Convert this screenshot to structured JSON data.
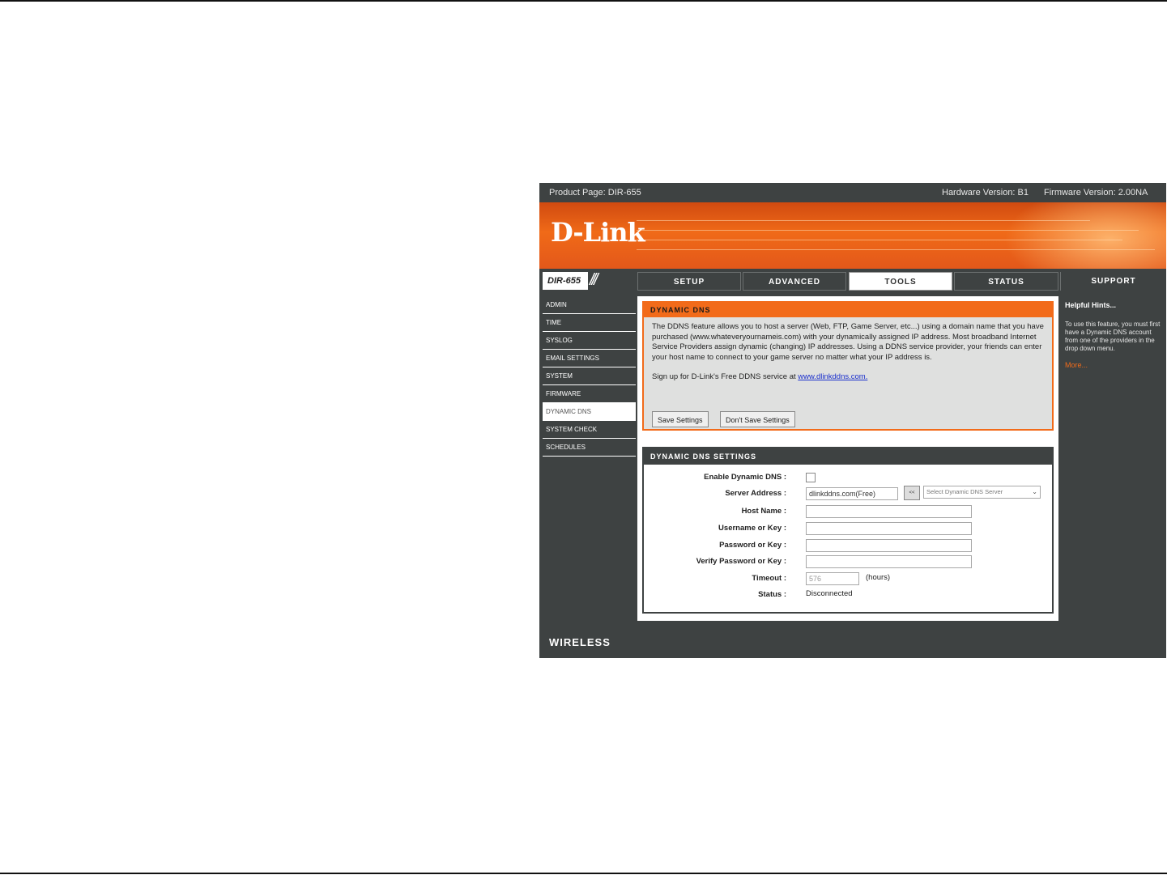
{
  "topbar": {
    "product": "Product Page: DIR-655",
    "hardware": "Hardware Version: B1",
    "firmware": "Firmware Version: 2.00NA"
  },
  "brand": {
    "logo": "D-Link",
    "footer": "WIRELESS"
  },
  "model": "DIR-655",
  "tabs": [
    {
      "label": "SETUP"
    },
    {
      "label": "ADVANCED"
    },
    {
      "label": "TOOLS"
    },
    {
      "label": "STATUS"
    }
  ],
  "support_tab": "SUPPORT",
  "sidebar": {
    "items": [
      {
        "label": "ADMIN"
      },
      {
        "label": "TIME"
      },
      {
        "label": "SYSLOG"
      },
      {
        "label": "EMAIL SETTINGS"
      },
      {
        "label": "SYSTEM"
      },
      {
        "label": "FIRMWARE"
      },
      {
        "label": "DYNAMIC DNS"
      },
      {
        "label": "SYSTEM CHECK"
      },
      {
        "label": "SCHEDULES"
      }
    ]
  },
  "ddns": {
    "title": "DYNAMIC DNS",
    "intro": "The DDNS feature allows you to host a server (Web, FTP, Game Server, etc...) using a domain name that you have purchased (www.whateveryournameis.com) with your dynamically assigned IP address. Most broadband Internet Service Providers assign dynamic (changing) IP addresses. Using a DDNS service provider, your friends can enter your host name to connect to your game server no matter what your IP address is.",
    "signup_text": "Sign up for D-Link's Free DDNS service at",
    "signup_link": "www.dlinkddns.com.",
    "save_label": "Save Settings",
    "dont_save_label": "Don't Save Settings"
  },
  "settings": {
    "title": "DYNAMIC DNS SETTINGS",
    "enable_label": "Enable Dynamic DNS :",
    "server_label": "Server Address :",
    "server_value": "dlinkddns.com(Free)",
    "server_btn": "<<",
    "server_select": "Select Dynamic DNS Server",
    "host_label": "Host Name :",
    "user_label": "Username or Key :",
    "pass_label": "Password or Key :",
    "verify_label": "Verify Password or Key :",
    "timeout_label": "Timeout :",
    "timeout_value": "576",
    "timeout_unit": "(hours)",
    "status_label": "Status :",
    "status_value": "Disconnected"
  },
  "help": {
    "title": "Helpful Hints...",
    "body": "To use this feature, you must first have a Dynamic DNS account from one of the providers in the drop down menu.",
    "more": "More..."
  }
}
